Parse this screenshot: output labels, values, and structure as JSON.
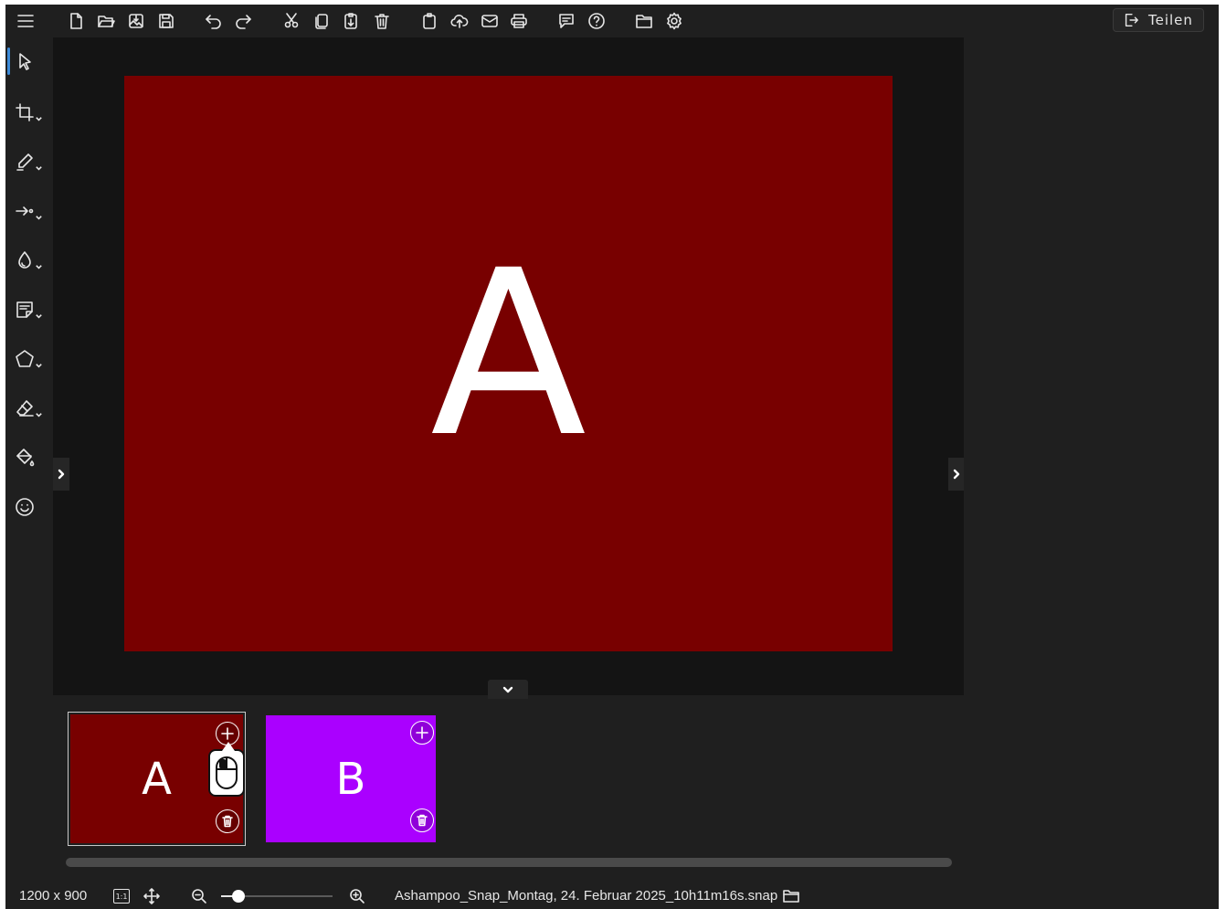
{
  "toolbar": {
    "icons": [
      "menu-icon",
      "new-file-icon",
      "open-folder-icon",
      "import-image-icon",
      "save-icon",
      "undo-icon",
      "redo-icon",
      "cut-icon",
      "copy-icon",
      "paste-icon",
      "delete-icon",
      "clipboard-icon",
      "upload-cloud-icon",
      "email-icon",
      "print-icon",
      "feedback-icon",
      "help-icon",
      "folder-icon",
      "settings-icon"
    ],
    "share_label": "Teilen"
  },
  "left_tools": [
    "select-tool",
    "crop-tool",
    "pen-tool",
    "arrow-tool",
    "blur-tool",
    "note-tool",
    "shape-tool",
    "eraser-tool",
    "fill-tool",
    "emoji-tool"
  ],
  "canvas": {
    "letter": "A",
    "background_color": "#780000"
  },
  "thumbnails": [
    {
      "letter": "A",
      "color": "#780000",
      "selected": true
    },
    {
      "letter": "B",
      "color": "#aa00ff",
      "selected": false
    }
  ],
  "status": {
    "dimensions": "1200 x 900",
    "one_to_one": "1:1",
    "zoom_fraction": 0.08,
    "filename": "Ashampoo_Snap_Montag, 24. Februar 2025_10h11m16s.snap"
  },
  "colors": {
    "app_bg": "#1f1f1f",
    "canvas_bg": "#141414",
    "accent": "#3c8ad8"
  }
}
